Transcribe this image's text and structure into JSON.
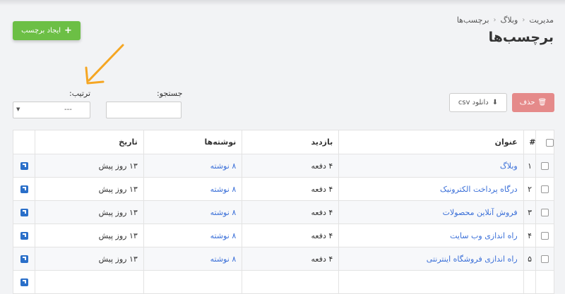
{
  "breadcrumb": {
    "items": [
      "مدیریت",
      "وبلاگ",
      "برچسب‌ها"
    ],
    "separator": "‹"
  },
  "page_title": "برچسب‌ها",
  "toolbar": {
    "add_label": "ایجاد برچسب",
    "delete_label": "حذف",
    "csv_label": "دانلود csv"
  },
  "filters": {
    "search_label": "جستجو:",
    "search_value": "",
    "sort_label": "ترتیب:",
    "sort_value": "---"
  },
  "table": {
    "headers": {
      "num": "#",
      "title": "عنوان",
      "visits": "بازدید",
      "posts": "نوشته‌ها",
      "date": "تاریخ"
    },
    "rows": [
      {
        "num": "۱",
        "title": "وبلاگ",
        "visits": "۴ دفعه",
        "posts": "۸ نوشته",
        "date": "۱۳ روز پیش"
      },
      {
        "num": "۲",
        "title": "درگاه پرداخت الکترونیک",
        "visits": "۴ دفعه",
        "posts": "۸ نوشته",
        "date": "۱۳ روز پیش"
      },
      {
        "num": "۳",
        "title": "فروش آنلاین محصولات",
        "visits": "۴ دفعه",
        "posts": "۸ نوشته",
        "date": "۱۳ روز پیش"
      },
      {
        "num": "۴",
        "title": "راه اندازی وب سایت",
        "visits": "۴ دفعه",
        "posts": "۸ نوشته",
        "date": "۱۳ روز پیش"
      },
      {
        "num": "۵",
        "title": "راه اندازی فروشگاه اینترنتی",
        "visits": "۴ دفعه",
        "posts": "۸ نوشته",
        "date": "۱۳ روز پیش"
      }
    ]
  },
  "colors": {
    "add_button": "#6cbf45",
    "delete_button": "#e58a8a",
    "link": "#3a6fd8",
    "arrow": "#f5a623",
    "edit_icon": "#2a6fc9"
  }
}
